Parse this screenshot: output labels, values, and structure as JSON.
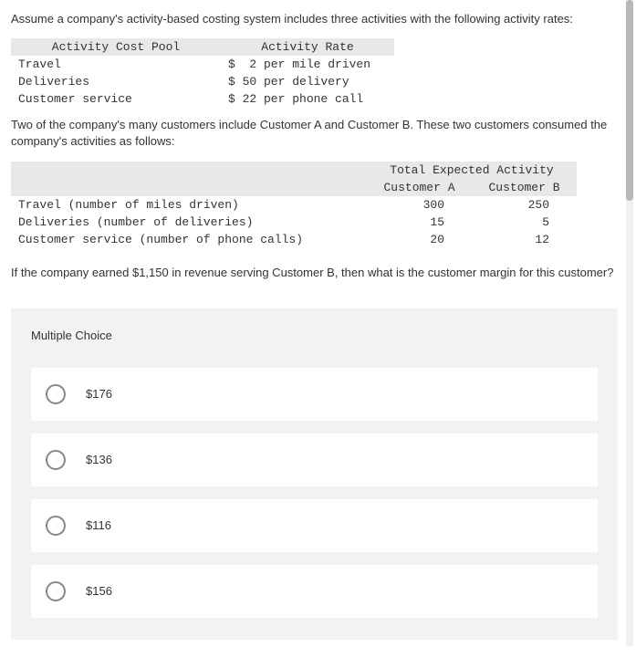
{
  "intro1": "Assume a company's activity-based costing system includes three activities with the following activity rates:",
  "table1": {
    "header": {
      "col1": "Activity Cost Pool",
      "col2": "Activity Rate"
    },
    "rows": [
      {
        "pool": "Travel",
        "rate": "$  2 per mile driven"
      },
      {
        "pool": "Deliveries",
        "rate": "$ 50 per delivery"
      },
      {
        "pool": "Customer service",
        "rate": "$ 22 per phone call"
      }
    ]
  },
  "intro2": "Two of the company's many customers include Customer A and Customer B. These two customers consumed the company's activities as follows:",
  "table2": {
    "topHeader": "Total Expected Activity",
    "subHeader": {
      "colA": "Customer A",
      "colB": "Customer B"
    },
    "rows": [
      {
        "label": "Travel (number of miles driven)",
        "a": "300",
        "b": "250"
      },
      {
        "label": "Deliveries (number of deliveries)",
        "a": "15",
        "b": "5"
      },
      {
        "label": "Customer service (number of phone calls)",
        "a": "20",
        "b": "12"
      }
    ]
  },
  "question": "If the company earned $1,150 in revenue serving Customer B, then what is the customer margin for this customer?",
  "mc": {
    "title": "Multiple Choice",
    "options": [
      "$176",
      "$136",
      "$116",
      "$156"
    ]
  }
}
